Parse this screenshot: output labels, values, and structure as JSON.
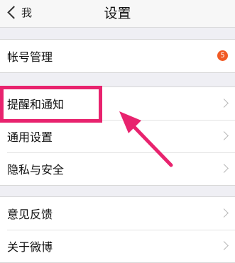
{
  "nav": {
    "back_label": "我",
    "title": "设置"
  },
  "groups": [
    {
      "items": [
        {
          "label": "帐号管理",
          "badge": "5"
        }
      ]
    },
    {
      "items": [
        {
          "label": "提醒和通知"
        },
        {
          "label": "通用设置"
        },
        {
          "label": "隐私与安全"
        }
      ]
    },
    {
      "items": [
        {
          "label": "意见反馈"
        },
        {
          "label": "关于微博"
        }
      ]
    }
  ],
  "colors": {
    "highlight": "#e8236e",
    "badge": "#f15a24",
    "background": "#efeff4"
  },
  "icons": [
    "back-chevron-icon",
    "chevron-right-icon"
  ]
}
